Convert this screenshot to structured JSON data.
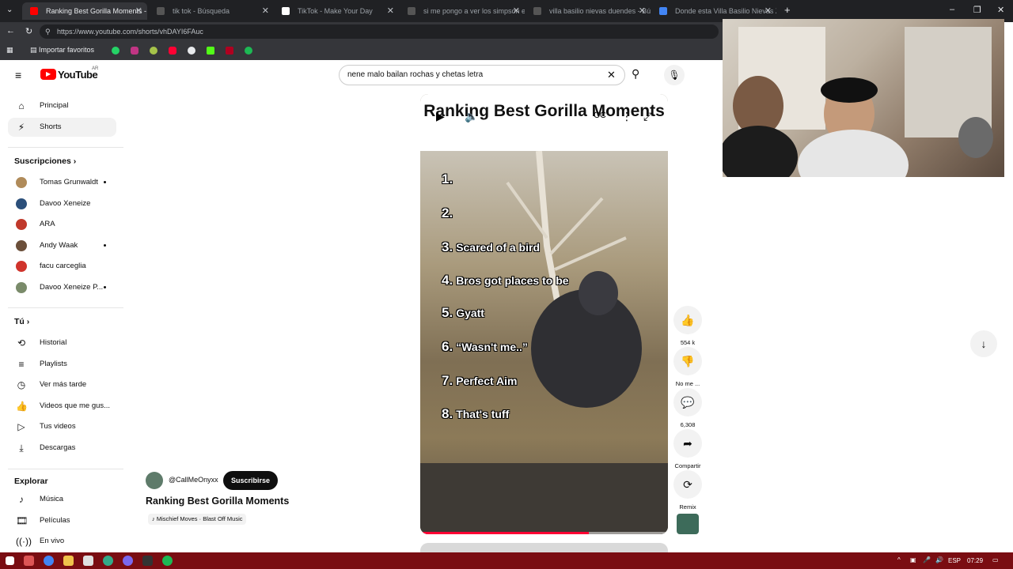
{
  "browser": {
    "tabs": [
      {
        "title": "Ranking Best Gorilla Moments - Yo",
        "active": true,
        "favicon_color": "#ff0000"
      },
      {
        "title": "tik tok - Búsqueda",
        "active": false,
        "favicon_color": "#555555"
      },
      {
        "title": "TikTok - Make Your Day",
        "active": false,
        "favicon_color": "#ffffff"
      },
      {
        "title": "si me pongo a ver los simpson en",
        "active": false,
        "favicon_color": "#555555"
      },
      {
        "title": "villa basilio nievas duendes - Bús",
        "active": false,
        "favicon_color": "#555555"
      },
      {
        "title": "Donde esta Villa Basilio Nievas Zo",
        "active": false,
        "favicon_color": "#4285f4"
      }
    ],
    "new_tab_label": "+",
    "url": "https://www.youtube.com/shorts/vhDAYI6FAuc",
    "bookmarks": {
      "import_label": "Importar favoritos",
      "icons": [
        "whatsapp-icon",
        "instagram-icon",
        "app-icon",
        "youtube-icon",
        "chatgpt-icon",
        "kick-icon",
        "app-icon-2",
        "spotify-icon"
      ]
    },
    "window_controls": [
      "–",
      "❐",
      "✕"
    ]
  },
  "youtube": {
    "logo_text": "YouTube",
    "logo_region": "AR",
    "search_value": "nene malo bailan rochas y chetas letra"
  },
  "sidebar": {
    "main": [
      {
        "label": "Principal",
        "icon": "⌂",
        "active": false
      },
      {
        "label": "Shorts",
        "icon": "⚡",
        "active": true
      }
    ],
    "subscriptions_title": "Suscripciones",
    "subscriptions": [
      {
        "label": "Tomas Grunwaldt",
        "color": "#b08b5a",
        "dot": true
      },
      {
        "label": "Davoo Xeneize",
        "color": "#2b4f7a",
        "dot": false
      },
      {
        "label": "ARA",
        "color": "#c0392b",
        "dot": false
      },
      {
        "label": "Andy Waak",
        "color": "#6b4f3a",
        "dot": true
      },
      {
        "label": "facu carceglia",
        "color": "#d0342c",
        "dot": false
      },
      {
        "label": "Davoo Xeneize P...",
        "color": "#7a8b6a",
        "dot": true
      }
    ],
    "you_title": "Tú",
    "you": [
      {
        "label": "Historial",
        "icon": "⟲"
      },
      {
        "label": "Playlists",
        "icon": "≡"
      },
      {
        "label": "Ver más tarde",
        "icon": "◷"
      },
      {
        "label": "Videos que me gus...",
        "icon": "👍"
      },
      {
        "label": "Tus videos",
        "icon": "▷"
      },
      {
        "label": "Descargas",
        "icon": "⤓"
      }
    ],
    "explore_title": "Explorar",
    "explore": [
      {
        "label": "Música",
        "icon": "♪"
      },
      {
        "label": "Películas",
        "icon": "🎞"
      },
      {
        "label": "En vivo",
        "icon": "((·))"
      }
    ]
  },
  "short": {
    "overlay_title": "Ranking Best Gorilla Moments",
    "rankings": [
      {
        "num": "1.",
        "text": ""
      },
      {
        "num": "2.",
        "text": ""
      },
      {
        "num": "3.",
        "text": "Scared of a bird"
      },
      {
        "num": "4.",
        "text": "Bros got places to be"
      },
      {
        "num": "5.",
        "text": "Gyatt"
      },
      {
        "num": "6.",
        "text": "“Wasn't me..”"
      },
      {
        "num": "7.",
        "text": "Perfect Aim"
      },
      {
        "num": "8.",
        "text": "That's tuff"
      }
    ],
    "progress_fraction": 0.68,
    "channel": "@CallMeOnyxx",
    "subscribe_label": "Suscribirse",
    "title": "Ranking Best Gorilla Moments",
    "music": "Mischief Moves · Blast Off Music"
  },
  "actions": [
    {
      "name": "like-button",
      "icon": "👍",
      "label": "554 k"
    },
    {
      "name": "dislike-button",
      "icon": "👎",
      "label": "No me ..."
    },
    {
      "name": "comments-button",
      "icon": "💬",
      "label": "6,308"
    },
    {
      "name": "share-button",
      "icon": "➦",
      "label": "Compartir"
    },
    {
      "name": "remix-button",
      "icon": "⟳",
      "label": "Remix"
    }
  ],
  "taskbar": {
    "language": "ESP",
    "time": "07:29"
  }
}
